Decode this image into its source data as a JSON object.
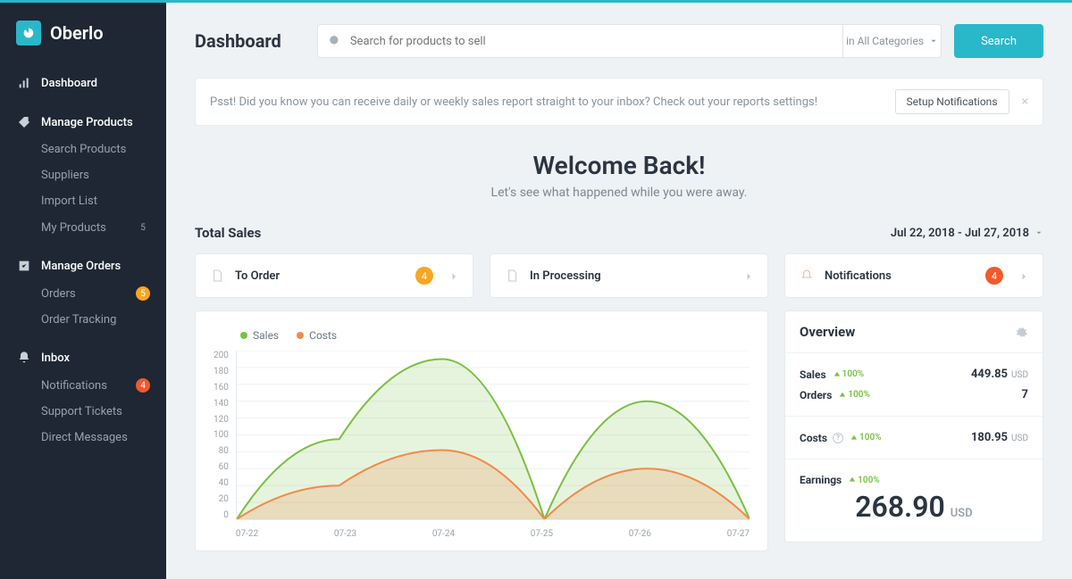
{
  "brand": {
    "name": "Oberlo"
  },
  "sidebar": {
    "dashboard": "Dashboard",
    "manage_products": "Manage Products",
    "search_products": "Search Products",
    "suppliers": "Suppliers",
    "import_list": "Import List",
    "my_products": "My Products",
    "my_products_badge": "5",
    "manage_orders": "Manage Orders",
    "orders": "Orders",
    "orders_badge": "5",
    "order_tracking": "Order Tracking",
    "inbox": "Inbox",
    "notifications": "Notifications",
    "notifications_badge": "4",
    "support_tickets": "Support Tickets",
    "direct_messages": "Direct Messages"
  },
  "header": {
    "title": "Dashboard",
    "search_placeholder": "Search for products to sell",
    "category_label": "in All Categories",
    "search_button": "Search"
  },
  "notice": {
    "text": "Psst! Did you know you can receive daily or weekly sales report straight to your inbox? Check out your reports settings!",
    "button": "Setup Notifications"
  },
  "welcome": {
    "title": "Welcome Back!",
    "subtitle": "Let's see what happened while you were away."
  },
  "total_sales": {
    "title": "Total Sales",
    "date_range": "Jul 22, 2018 - Jul 27, 2018"
  },
  "pills": {
    "to_order": {
      "label": "To Order",
      "badge": "4"
    },
    "in_processing": {
      "label": "In Processing"
    },
    "notifications": {
      "label": "Notifications",
      "badge": "4"
    }
  },
  "overview": {
    "title": "Overview",
    "sales": {
      "label": "Sales",
      "trend": "100%",
      "value": "449.85",
      "currency": "USD"
    },
    "orders": {
      "label": "Orders",
      "trend": "100%",
      "value": "7"
    },
    "costs": {
      "label": "Costs",
      "trend": "100%",
      "value": "180.95",
      "currency": "USD"
    },
    "earnings": {
      "label": "Earnings",
      "trend": "100%",
      "value": "268.90",
      "currency": "USD"
    }
  },
  "chart_legend": {
    "sales": "Sales",
    "costs": "Costs"
  },
  "chart_data": {
    "type": "area",
    "x": [
      "07-22",
      "07-23",
      "07-24",
      "07-25",
      "07-26",
      "07-27"
    ],
    "series": [
      {
        "name": "Sales",
        "color": "#7ac142",
        "values": [
          0,
          95,
          190,
          0,
          140,
          0
        ]
      },
      {
        "name": "Costs",
        "color": "#f08a4b",
        "values": [
          0,
          40,
          82,
          0,
          60,
          0
        ]
      }
    ],
    "ylim": [
      0,
      200
    ],
    "yticks": [
      200,
      180,
      160,
      140,
      120,
      100,
      80,
      60,
      40,
      20,
      0
    ],
    "xlabel": "",
    "ylabel": ""
  }
}
